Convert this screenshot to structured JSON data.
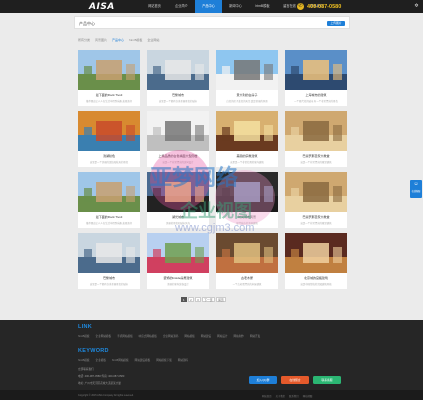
{
  "header": {
    "logo": "AISA",
    "nav": [
      "网站首页",
      "企业简介",
      "产品中心",
      "新闻中心",
      "html5模板",
      "留言在线",
      "联系我们"
    ],
    "active_nav_index": 2,
    "phone": "400-087-0580",
    "accent": "#1e7fd8"
  },
  "heading": {
    "title": "产品中心",
    "button": "上传图片"
  },
  "filters": [
    "所有分类",
    "风景图片",
    "产品中心",
    "html5模板",
    "企业网站"
  ],
  "active_filter_index": 2,
  "products": [
    {
      "title": "最下面的Rock Tivoli",
      "desc": "推荐理由让人人在生活中得到乐趣,发现美好"
    },
    {
      "title": "巴黎城市",
      "desc": "这里是一个拥有许多美丽景色的城市"
    },
    {
      "title": "意大利的白房子",
      "desc": "白色的房子蓝色的天空,真是美丽的风景"
    },
    {
      "title": "上海城市的建筑",
      "desc": "一个现代化的城市,有一个非常漂亮的景色"
    },
    {
      "title": "滨湖秋色",
      "desc": "这里是一个美丽的湖泊和秋天的景色"
    },
    {
      "title": "上乘品质的白色墙面大型阁楼",
      "desc": "这是一个非常漂亮的房间设计"
    },
    {
      "title": "美丽的宗教建筑",
      "desc": "这里是一个非常壮观的室内建筑"
    },
    {
      "title": "巴塞罗那圣家大教堂",
      "desc": "这是一个非常漂亮的教堂建筑"
    },
    {
      "title": "最下面的Rock Tivoli",
      "desc": "推荐理由让人人在生活中得到乐趣,发现美好"
    },
    {
      "title": "湖光城市",
      "desc": "美丽的景色和城市风光"
    },
    {
      "title": "时尚城市风景",
      "desc": "现代城市的美丽建筑"
    },
    {
      "title": "巴塞罗那圣家大教堂",
      "desc": "这是一个非常漂亮的教堂建筑"
    },
    {
      "title": "巴黎城市",
      "desc": "这里是一个拥有许多美丽景色的城市"
    },
    {
      "title": "装饰的Inside房屋建筑",
      "desc": "美丽的室内装饰设计"
    },
    {
      "title": "古老木屋",
      "desc": "一个古老而漂亮的木屋建筑"
    },
    {
      "title": "北京城的宫殿建筑",
      "desc": "这是中国传统的宫殿建筑风格"
    }
  ],
  "pagination": {
    "pages": [
      "1",
      "2",
      "3"
    ],
    "active": "1",
    "next": "下一页",
    "last": "尾页"
  },
  "footer": {
    "link_heading": "LINK",
    "links": [
      "html5模板",
      "企业网站模板",
      "手机网站模板",
      "响应式网站模板",
      "企业网站源码",
      "网站模板",
      "网站建设",
      "网站设计",
      "网站制作",
      "网站开发"
    ],
    "keyword_heading": "KEYWORD",
    "keywords": [
      "html5模板",
      "企业模板",
      "html5网站模板",
      "网站建设模板",
      "网站模板下载",
      "网站源码"
    ],
    "contact_title": "立即联系我们",
    "contact_lines": [
      "电话: 400-087-0580  传真: 400-087-0580",
      "地址: 广州市天河区花城大道某某大厦"
    ],
    "share_buttons": [
      {
        "label": "加入QQ群",
        "color": "#1e7fd8"
      },
      {
        "label": "在线留言",
        "color": "#e55a2b"
      },
      {
        "label": "联系客服",
        "color": "#2bb673"
      }
    ],
    "copyright": "Copyright © 2015 AISA Company All rights reserved.",
    "bottom_links": [
      "网站首页",
      "关于我们",
      "联系我们",
      "网站地图"
    ]
  },
  "side_float": {
    "label": "在线客服"
  },
  "watermark": {
    "line1": "亚梦网络",
    "line2": "企业视图",
    "line3": "www.cgjm3.com"
  }
}
